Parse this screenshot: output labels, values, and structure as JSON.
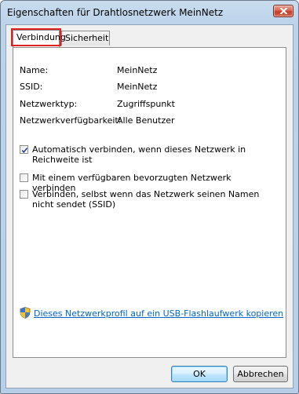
{
  "window": {
    "title": "Eigenschaften für Drahtlosnetzwerk MeinNetz"
  },
  "tabs": [
    {
      "label": "Verbindung",
      "active": true,
      "highlighted": true
    },
    {
      "label": "Sicherheit",
      "active": false
    }
  ],
  "info": {
    "name_label": "Name:",
    "name_value": "MeinNetz",
    "ssid_label": "SSID:",
    "ssid_value": "MeinNetz",
    "type_label": "Netzwerktyp:",
    "type_value": "Zugriffspunkt",
    "availability_label": "Netzwerkverfügbarkeit:",
    "availability_value": "Alle Benutzer"
  },
  "options": [
    {
      "label": "Automatisch verbinden, wenn dieses Netzwerk in Reichweite ist",
      "checked": true
    },
    {
      "label": "Mit einem verfügbaren bevorzugten Netzwerk verbinden",
      "checked": false
    },
    {
      "label": "Verbinden, selbst wenn das Netzwerk seinen Namen nicht sendet (SSID)",
      "checked": false
    }
  ],
  "link": {
    "text": "Dieses Netzwerkprofil auf ein USB-Flashlaufwerk kopieren",
    "icon": "uac-shield-icon"
  },
  "buttons": {
    "ok": "OK",
    "cancel": "Abbrechen"
  },
  "colors": {
    "highlight_box": "#e0221e",
    "link": "#0066cc"
  }
}
